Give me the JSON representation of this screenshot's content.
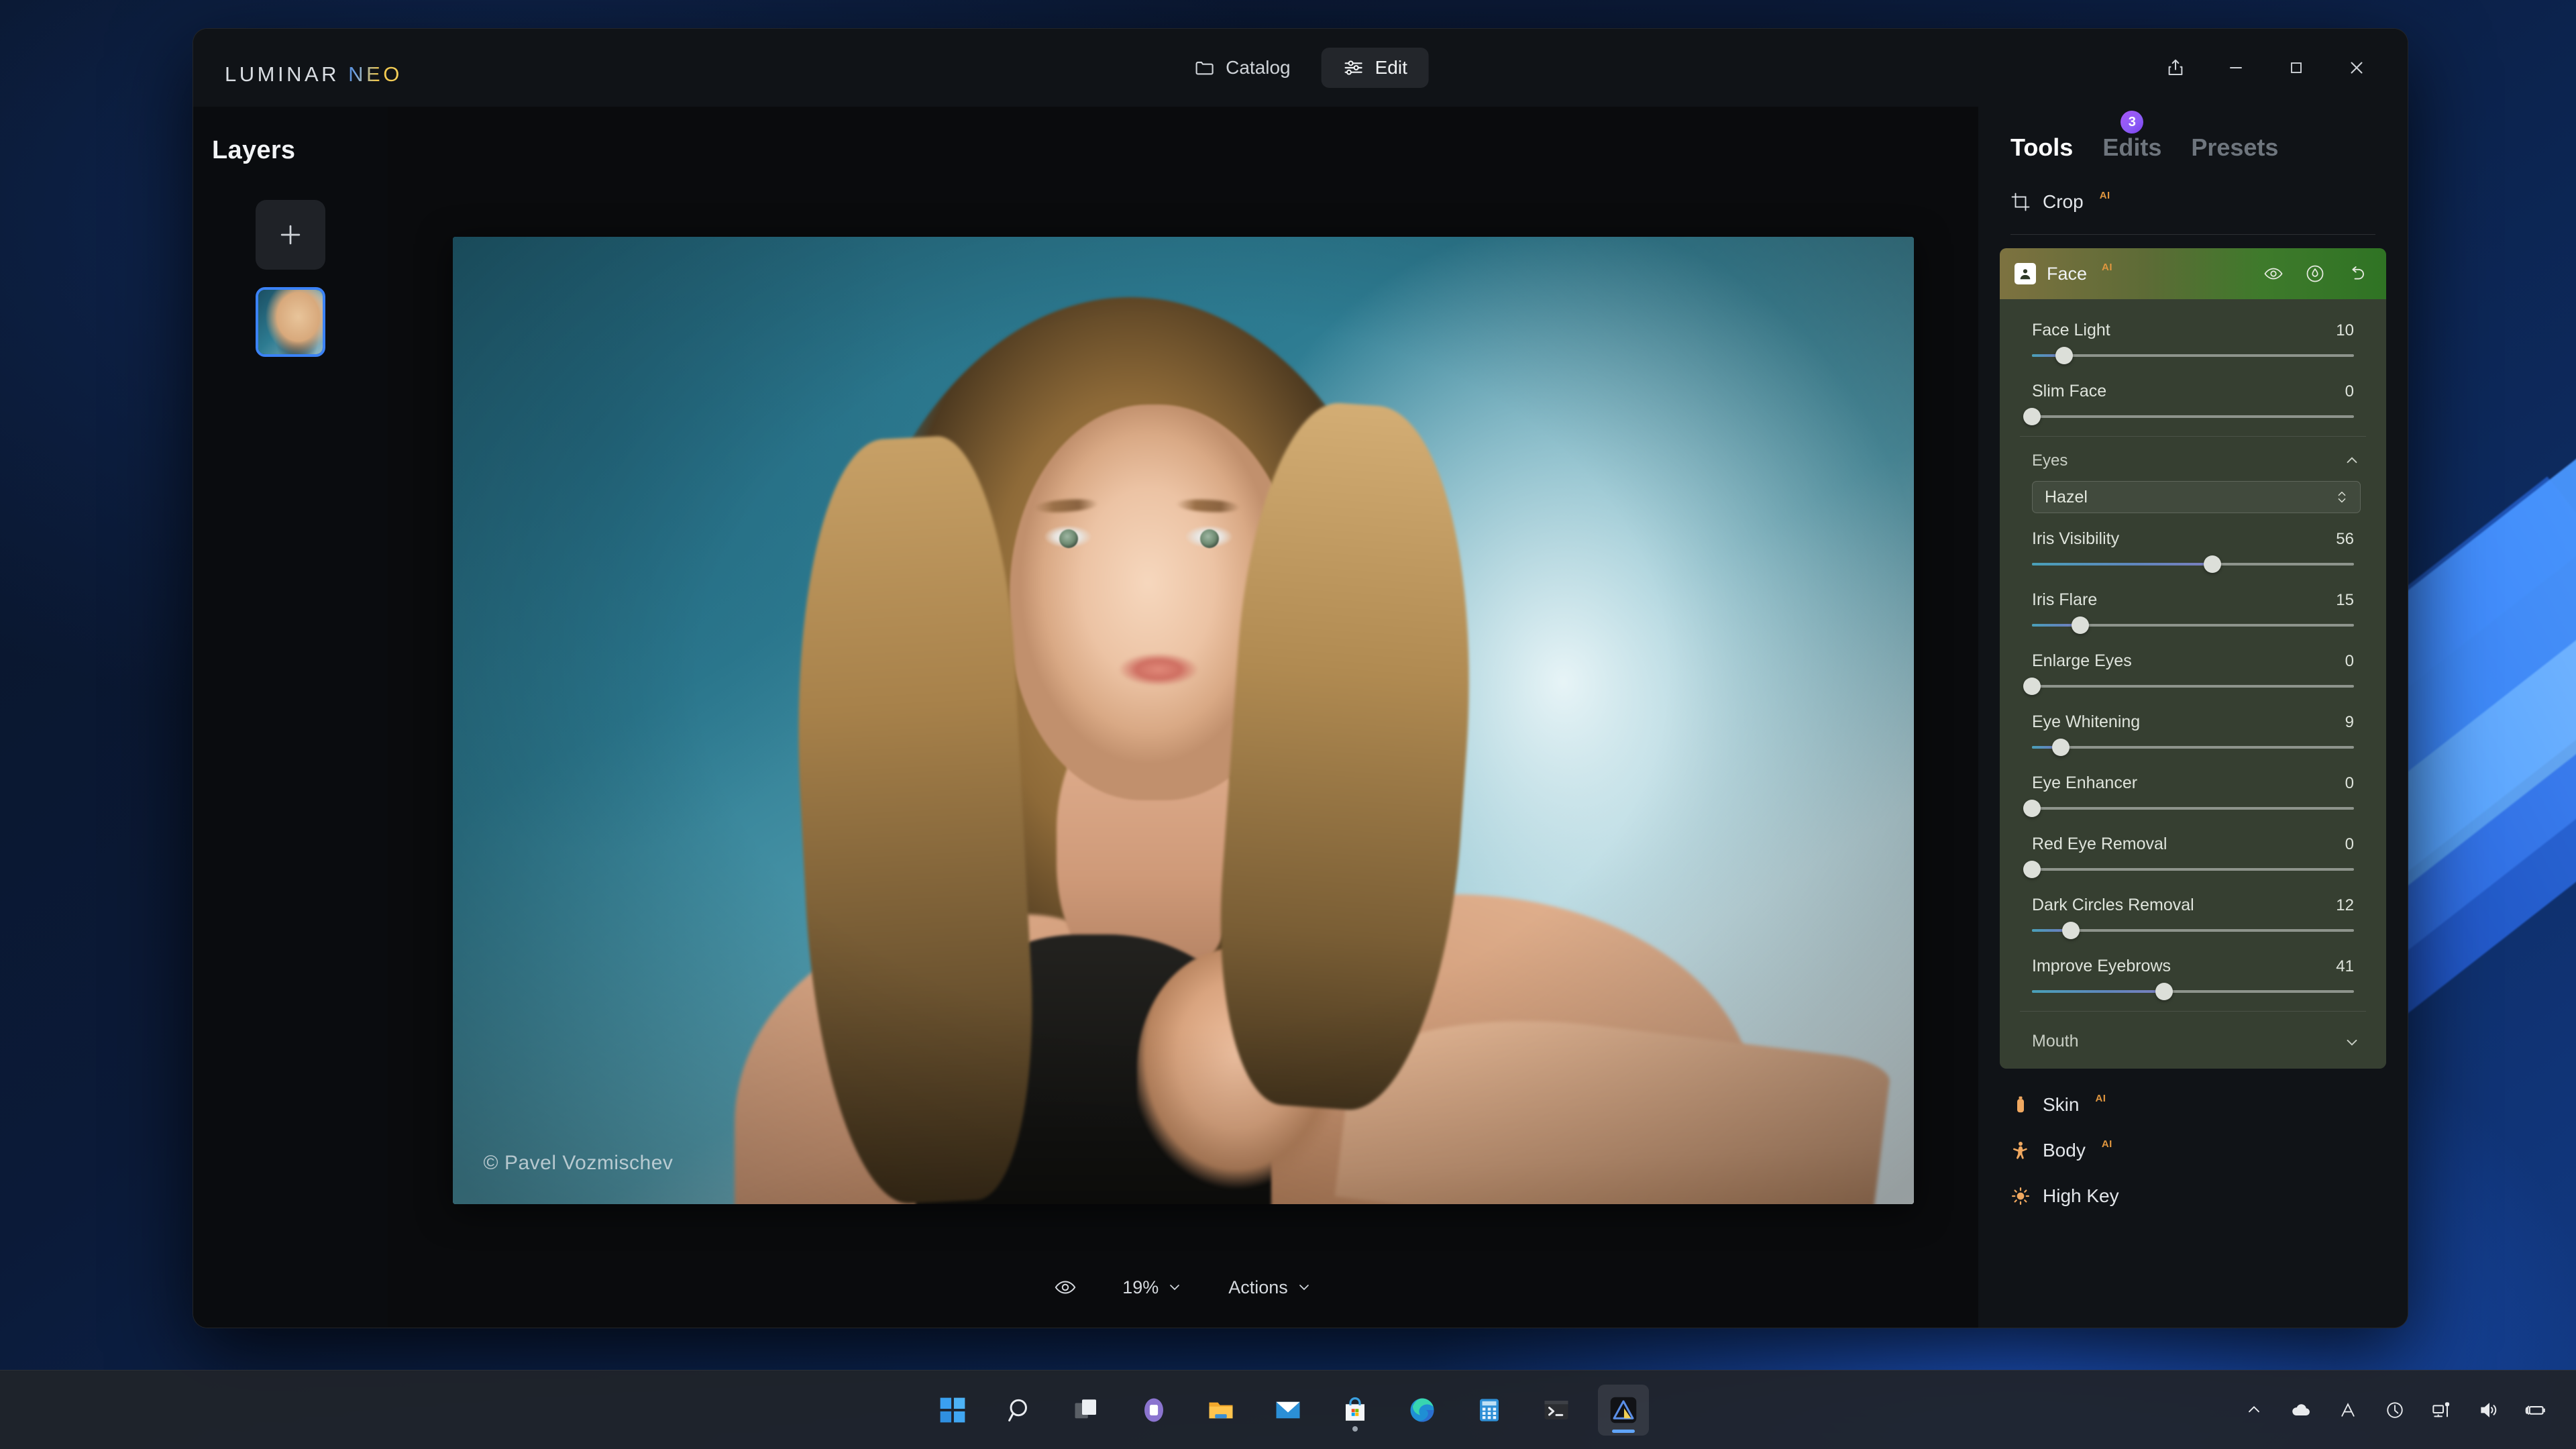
{
  "app": {
    "logo_primary": "LUMINAR",
    "logo_secondary": "NEO",
    "accent_blue": "#3b82f6",
    "accent_ai": "#e0963f",
    "accent_badge": "#8b5cf6"
  },
  "titlebar": {
    "catalog_label": "Catalog",
    "edit_label": "Edit",
    "share_icon": "share-icon",
    "minimize_icon": "minimize-icon",
    "maximize_icon": "maximize-icon",
    "close_icon": "close-icon"
  },
  "left_panel": {
    "title": "Layers",
    "add_layer_icon": "plus-icon",
    "layer_thumbnail_name": "layer-thumbnail"
  },
  "canvas": {
    "watermark": "© Pavel Vozmischev"
  },
  "bottom_bar": {
    "preview_icon": "eye-icon",
    "zoom_level": "19%",
    "actions_label": "Actions",
    "chevron_icon": "chevron-down-icon"
  },
  "right_panel": {
    "tabs": [
      {
        "label": "Tools",
        "active": true,
        "badge": null
      },
      {
        "label": "Edits",
        "active": false,
        "badge": "3"
      },
      {
        "label": "Presets",
        "active": false,
        "badge": null
      }
    ],
    "ai_badge_text": "AI",
    "tools_top": [
      {
        "label": "Crop",
        "ai": true,
        "icon": "crop-icon"
      }
    ],
    "face_module": {
      "title": "Face",
      "ai": true,
      "icon": "portrait-icon",
      "header_actions": [
        {
          "name": "visibility-toggle",
          "icon": "eye-icon"
        },
        {
          "name": "mask-button",
          "icon": "mask-icon"
        },
        {
          "name": "reset-button",
          "icon": "undo-icon"
        }
      ],
      "sliders_top": [
        {
          "label": "Face Light",
          "value": "10",
          "percent": 10
        },
        {
          "label": "Slim Face",
          "value": "0",
          "percent": 0
        }
      ],
      "eyes_section": {
        "label": "Eyes",
        "expanded": true,
        "chevron_icon": "chevron-up-icon",
        "eye_color_select": {
          "value": "Hazel",
          "stepper_icon": "stepper-updown-icon"
        },
        "sliders": [
          {
            "label": "Iris Visibility",
            "value": "56",
            "percent": 56
          },
          {
            "label": "Iris Flare",
            "value": "15",
            "percent": 15
          },
          {
            "label": "Enlarge Eyes",
            "value": "0",
            "percent": 0
          },
          {
            "label": "Eye Whitening",
            "value": "9",
            "percent": 9
          },
          {
            "label": "Eye Enhancer",
            "value": "0",
            "percent": 0
          },
          {
            "label": "Red Eye Removal",
            "value": "0",
            "percent": 0
          },
          {
            "label": "Dark Circles Removal",
            "value": "12",
            "percent": 12
          },
          {
            "label": "Improve Eyebrows",
            "value": "41",
            "percent": 41
          }
        ]
      },
      "mouth_section": {
        "label": "Mouth",
        "expanded": false,
        "chevron_icon": "chevron-down-icon"
      }
    },
    "tools_bottom": [
      {
        "label": "Skin",
        "ai": true,
        "icon": "skin-bottle-icon"
      },
      {
        "label": "Body",
        "ai": true,
        "icon": "body-person-icon"
      },
      {
        "label": "High Key",
        "ai": false,
        "icon": "high-key-sun-icon"
      }
    ]
  },
  "taskbar": {
    "items": [
      {
        "name": "start-button",
        "icon": "windows-logo-icon",
        "active": false
      },
      {
        "name": "search-button",
        "icon": "search-icon",
        "active": false
      },
      {
        "name": "task-view-button",
        "icon": "task-view-icon",
        "active": false
      },
      {
        "name": "teams-button",
        "icon": "teams-icon",
        "active": false
      },
      {
        "name": "file-explorer-button",
        "icon": "folder-icon",
        "active": false
      },
      {
        "name": "mail-button",
        "icon": "mail-icon",
        "active": false
      },
      {
        "name": "microsoft-store-button",
        "icon": "store-bag-icon",
        "active": false
      },
      {
        "name": "edge-button",
        "icon": "edge-icon",
        "active": false
      },
      {
        "name": "calculator-button",
        "icon": "calculator-icon",
        "active": false
      },
      {
        "name": "terminal-button",
        "icon": "terminal-icon",
        "active": false
      },
      {
        "name": "luminar-neo-button",
        "icon": "luminar-icon",
        "active": true
      }
    ],
    "tray": [
      {
        "name": "show-hidden-icons",
        "icon": "chevron-up-icon"
      },
      {
        "name": "onedrive-status",
        "icon": "cloud-icon"
      },
      {
        "name": "language-indicator",
        "icon": "language-a-icon"
      },
      {
        "name": "sync-status",
        "icon": "clock-circle-icon"
      },
      {
        "name": "network-status",
        "icon": "network-icon"
      },
      {
        "name": "volume-status",
        "icon": "speaker-icon"
      },
      {
        "name": "battery-status",
        "icon": "battery-charging-icon"
      }
    ]
  }
}
